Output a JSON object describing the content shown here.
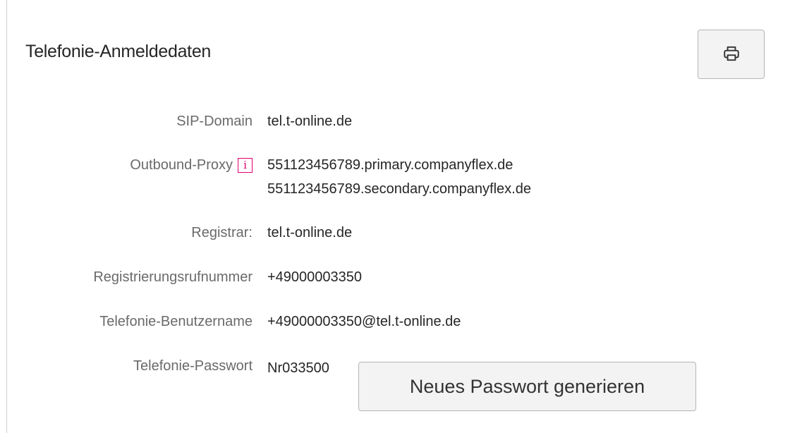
{
  "section": {
    "title": "Telefonie-Anmeldedaten",
    "print_icon": "printer-icon"
  },
  "fields": {
    "sip_domain": {
      "label": "SIP-Domain",
      "value": "tel.t-online.de"
    },
    "outbound_proxy": {
      "label": "Outbound-Proxy",
      "info_icon_glyph": "i",
      "value_primary": "551123456789.primary.companyflex.de",
      "value_secondary": "551123456789.secondary.companyflex.de"
    },
    "registrar": {
      "label": "Registrar:",
      "value": "tel.t-online.de"
    },
    "registration_number": {
      "label": "Registrierungsrufnummer",
      "value": "+49000003350"
    },
    "username": {
      "label": "Telefonie-Benutzername",
      "value": "+49000003350@tel.t-online.de"
    },
    "password": {
      "label": "Telefonie-Passwort",
      "value": "Nr033500"
    }
  },
  "actions": {
    "generate_password_label": "Neues Passwort generieren"
  },
  "colors": {
    "accent": "#e20074",
    "label": "#6a6a6a",
    "text": "#262626",
    "button_bg": "#f3f3f3",
    "border": "#b5b5b5"
  }
}
